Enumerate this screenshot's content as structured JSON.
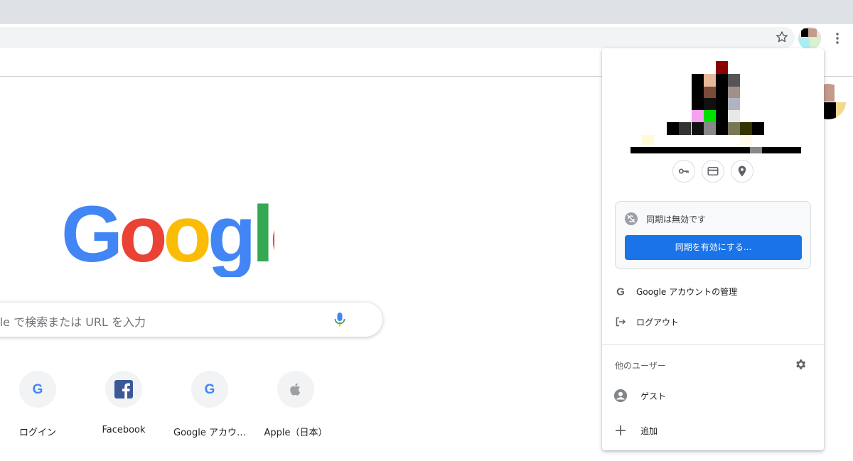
{
  "browser": {
    "star_icon": "star-icon",
    "menu_icon": "kebab-menu-icon"
  },
  "ntp": {
    "logo_text": "Google",
    "logo_colors": [
      "#4285F4",
      "#EA4335",
      "#FBBC05",
      "#4285F4",
      "#34A853",
      "#EA4335"
    ],
    "search_placeholder": "oogle で検索または URL を入力",
    "shortcuts": [
      {
        "label": "ログイン",
        "icon": "google-g-icon"
      },
      {
        "label": "Facebook",
        "icon": "facebook-icon"
      },
      {
        "label": "Google アカウ…",
        "icon": "google-g-icon"
      },
      {
        "label": "Apple（日本）",
        "icon": "apple-icon"
      }
    ]
  },
  "profile_menu": {
    "quick_actions": [
      "key-icon",
      "credit-card-icon",
      "location-pin-icon"
    ],
    "sync": {
      "status": "同期は無効です",
      "button": "同期を有効にする..."
    },
    "manage_account": "Google アカウントの管理",
    "logout": "ログアウト",
    "other_users_heading": "他のユーザー",
    "guest": "ゲスト",
    "add": "追加"
  },
  "colors": {
    "accent": "#1a73e8",
    "tabstrip": "#dee1e6",
    "omnibox": "#f1f3f4"
  }
}
